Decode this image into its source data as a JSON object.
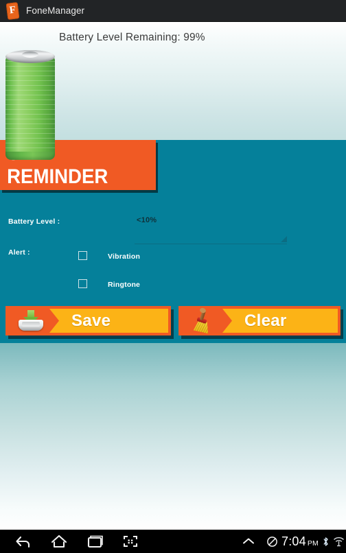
{
  "titlebar": {
    "app_name": "FoneManager",
    "icon": "phone-app-icon",
    "icon_letter": "F",
    "bg": "#222426"
  },
  "battery_status": {
    "text": "Battery Level Remaining: 99%",
    "percent": 99,
    "graphic": "battery-cell-illustration",
    "fill_color": "#7ac456"
  },
  "banner": {
    "label": "SET REMINDER",
    "bg": "#f05a24",
    "text_color": "#ffffff"
  },
  "form": {
    "panel_color": "#05809a",
    "battery_level": {
      "label": "Battery Level :",
      "selected": "<10%",
      "caret_icon": "dropdown-caret-icon"
    },
    "alert": {
      "label": "Alert :",
      "options": [
        {
          "label": "Vibration",
          "checked": false
        },
        {
          "label": "Ringtone",
          "checked": false
        }
      ]
    }
  },
  "actions": {
    "save": {
      "label": "Save",
      "icon": "save-tray-icon"
    },
    "clear": {
      "label": "Clear",
      "icon": "broom-icon"
    },
    "bg": "#f05a24",
    "chevron_bg": "#fcb316"
  },
  "navbar": {
    "buttons": [
      {
        "name": "back-nav-button",
        "icon": "back-arrow-icon"
      },
      {
        "name": "home-nav-button",
        "icon": "home-icon"
      },
      {
        "name": "recents-nav-button",
        "icon": "recents-square-icon"
      },
      {
        "name": "screenshot-nav-button",
        "icon": "screenshot-frame-icon"
      },
      {
        "name": "expand-nav-button",
        "icon": "chevron-up-icon"
      }
    ],
    "status": {
      "mute_icon": "mute-circle-slash-icon",
      "time": "7:04",
      "meridiem": "PM",
      "bluetooth_icon": "bluetooth-icon",
      "wifi_icon": "wifi-icon",
      "signal_icon": "cellular-signal-icon",
      "battery_icon": "battery-icon"
    }
  }
}
